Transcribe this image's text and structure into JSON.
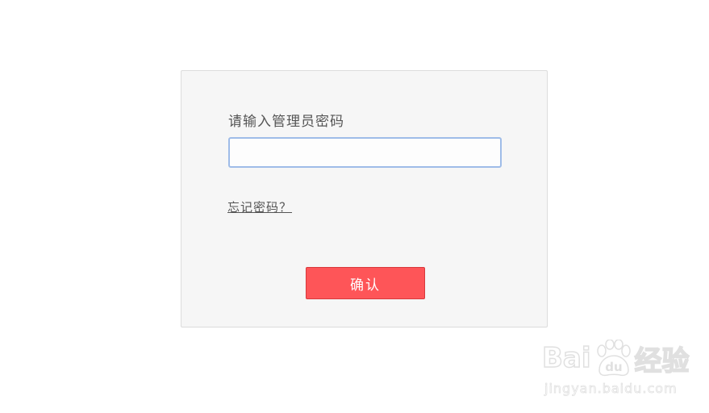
{
  "login": {
    "prompt": "请输入管理员密码",
    "password_value": "",
    "forgot_link": "忘记密码？",
    "confirm_label": "确认"
  },
  "watermark": {
    "logo_text_left": "Bai",
    "logo_text_right": "经验",
    "paw_text": "du",
    "url": "jingyan.baidu.com"
  },
  "colors": {
    "panel_background": "#f6f6f6",
    "input_border": "#9fbce8",
    "confirm_button": "#fe5558",
    "label_text": "#555555"
  }
}
